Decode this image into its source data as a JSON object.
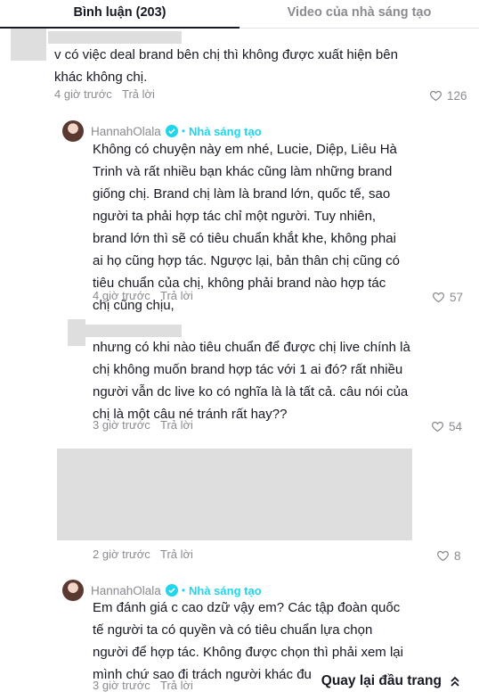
{
  "tabs": [
    {
      "label": "Bình luận (203)"
    },
    {
      "label": "Video của nhà sáng tạo"
    }
  ],
  "comments": [
    {
      "text_lines": [
        "v có việc deal brand bên chị thì không được xuất hiện bên",
        "khác không chị."
      ],
      "time": "4 giờ trước",
      "reply": "Trả lời",
      "likes": "126"
    },
    {
      "author": "HannahOlala",
      "badge": "Nhà sáng tạo",
      "text_lines": [
        "Không có chuyện này em nhé, Lucie, Diệp, Liêu Hà",
        "Trinh và rất nhiều bạn khác cũng làm những brand",
        "giống chị. Brand chị làm là brand lớn, quốc tế, sao",
        "người ta phải hợp tác chỉ một người. Tuy nhiên,",
        "brand lớn thì sẽ có tiêu chuẩn khắt khe, không phai",
        "ai họ cũng hợp tác. Ngược lại, bản thân chị cũng có",
        "tiêu chuẩn của chị, không phải brand nào hợp tác",
        "chị cũng chịu,"
      ],
      "time": "4 giờ trước",
      "reply": "Trả lời",
      "likes": "57"
    },
    {
      "text_lines": [
        "nhưng có khi nào tiêu chuẩn để được chị live chính là",
        "chị không muốn brand hợp tác với 1 ai đó? rất nhiều",
        "người vẫn dc live ko có nghĩa là là tất cả. câu nói của",
        "chị là một câu né tránh rất hay??"
      ],
      "time": "3 giờ trước",
      "reply": "Trả lời",
      "likes": "54"
    },
    {
      "time": "2 giờ trước",
      "reply": "Trả lời",
      "likes": "8"
    },
    {
      "author": "HannahOlala",
      "badge": "Nhà sáng tạo",
      "text_lines": [
        "Em đánh giá c cao dzữ vậy em? Các tập đoàn quốc",
        "tế người ta có quyền và có tiêu chuẩn lựa chọn",
        "người để hợp tác. Không được chọn thì phải xem lại",
        "mình chứ sao đi trách người khác được"
      ],
      "time": "3 giờ trước",
      "reply": "Trả lời"
    }
  ],
  "back_to_top": "Quay lại đầu trang",
  "colors": {
    "creator_accent": "#20d5ec",
    "muted": "#8a8b91",
    "text": "#161823"
  },
  "icons": {
    "like": "heart-outline-icon",
    "verified": "verified-check-icon",
    "back_top": "double-chevron-up-icon"
  }
}
